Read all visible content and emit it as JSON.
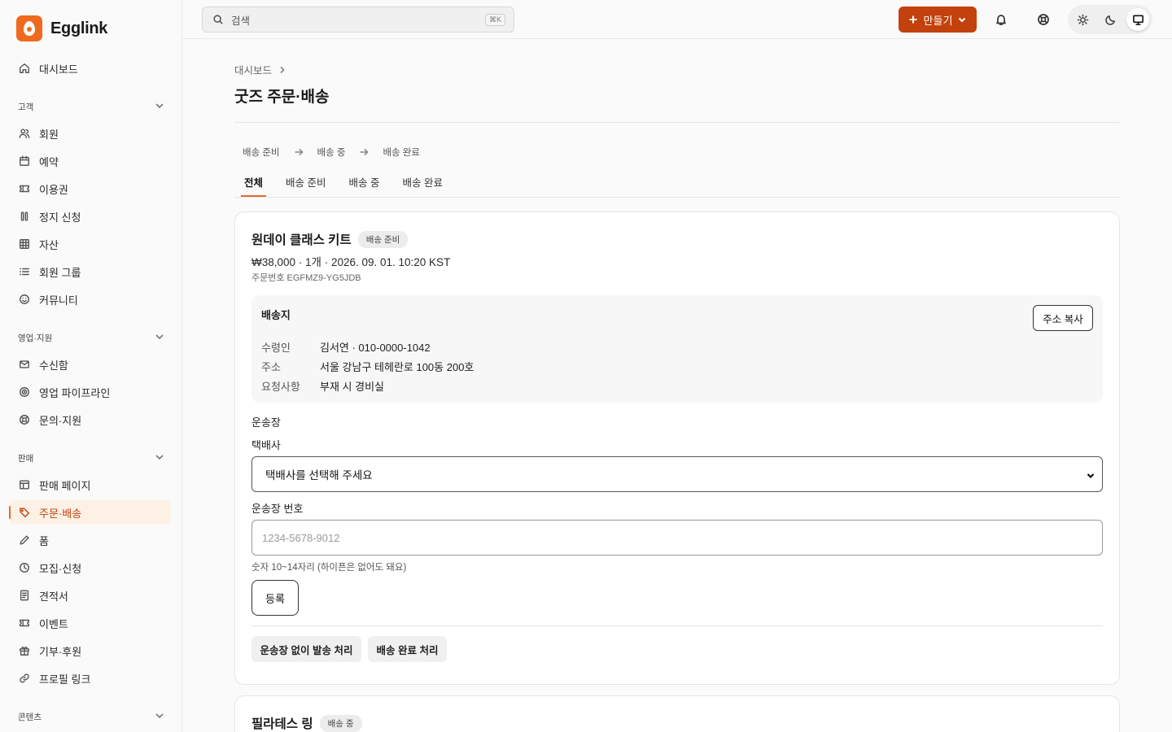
{
  "brand": {
    "name": "Egglink",
    "accent": "#c2410c",
    "accent_light": "#ef6a1f"
  },
  "sidebar": {
    "dashboard": {
      "label": "대시보드",
      "icon": "home-icon"
    },
    "sections": [
      {
        "label": "고객",
        "items": [
          {
            "label": "회원",
            "icon": "users-icon"
          },
          {
            "label": "예약",
            "icon": "calendar-icon"
          },
          {
            "label": "이용권",
            "icon": "ticket-icon"
          },
          {
            "label": "정지 신청",
            "icon": "pause-icon"
          },
          {
            "label": "자산",
            "icon": "grid-icon"
          },
          {
            "label": "회원 그룹",
            "icon": "list-icon"
          },
          {
            "label": "커뮤니티",
            "icon": "smile-icon"
          }
        ]
      },
      {
        "label": "영업·지원",
        "items": [
          {
            "label": "수신함",
            "icon": "mail-icon"
          },
          {
            "label": "영업 파이프라인",
            "icon": "target-icon"
          },
          {
            "label": "문의·지원",
            "icon": "lifebuoy-icon"
          }
        ]
      },
      {
        "label": "판매",
        "items": [
          {
            "label": "판매 페이지",
            "icon": "layout-icon"
          },
          {
            "label": "주문·배송",
            "icon": "tag-icon",
            "active": true
          },
          {
            "label": "폼",
            "icon": "pencil-icon"
          },
          {
            "label": "모집·신청",
            "icon": "clock-icon"
          },
          {
            "label": "견적서",
            "icon": "document-icon"
          },
          {
            "label": "이벤트",
            "icon": "ticket-icon"
          },
          {
            "label": "기부·후원",
            "icon": "gift-icon"
          },
          {
            "label": "프로필 링크",
            "icon": "link-icon"
          }
        ]
      },
      {
        "label": "콘텐츠",
        "items": []
      }
    ]
  },
  "topbar": {
    "search_placeholder": "검색",
    "search_shortcut": "⌘K",
    "create_label": "만들기",
    "theme_selected": "system"
  },
  "main": {
    "breadcrumb": "대시보드",
    "title": "굿즈 주문·배송",
    "flow": [
      "배송 준비",
      "배송 중",
      "배송 완료"
    ],
    "tabs": [
      "전체",
      "배송 준비",
      "배송 중",
      "배송 완료"
    ],
    "active_tab": "전체"
  },
  "orders": [
    {
      "product": "원데이 클래스 키트",
      "status": "배송 준비",
      "meta": "₩38,000 · 1개 · 2026. 09. 01. 10:20 KST",
      "order_no": "주문번호 EGFMZ9-YG5JDB",
      "shipping": {
        "title": "배송지",
        "copy_label": "주소 복사",
        "rows": [
          {
            "key": "수령인",
            "value": "김서연 · 010-0000-1042"
          },
          {
            "key": "주소",
            "value": "서울 강남구 테헤란로 100동 200호"
          },
          {
            "key": "요청사항",
            "value": "부재 시 경비실"
          }
        ]
      },
      "waybill": {
        "section_title": "운송장",
        "carrier_label": "택배사",
        "carrier_value": "택배사를 선택해 주세요",
        "number_label": "운송장 번호",
        "number_placeholder": "1234-5678-9012",
        "hint": "숫자 10~14자리 (하이픈은 없어도 돼요)",
        "register_label": "등록"
      },
      "actions": [
        "운송장 없이 발송 처리",
        "배송 완료 처리"
      ]
    },
    {
      "product": "필라테스 링",
      "status": "배송 중"
    }
  ]
}
